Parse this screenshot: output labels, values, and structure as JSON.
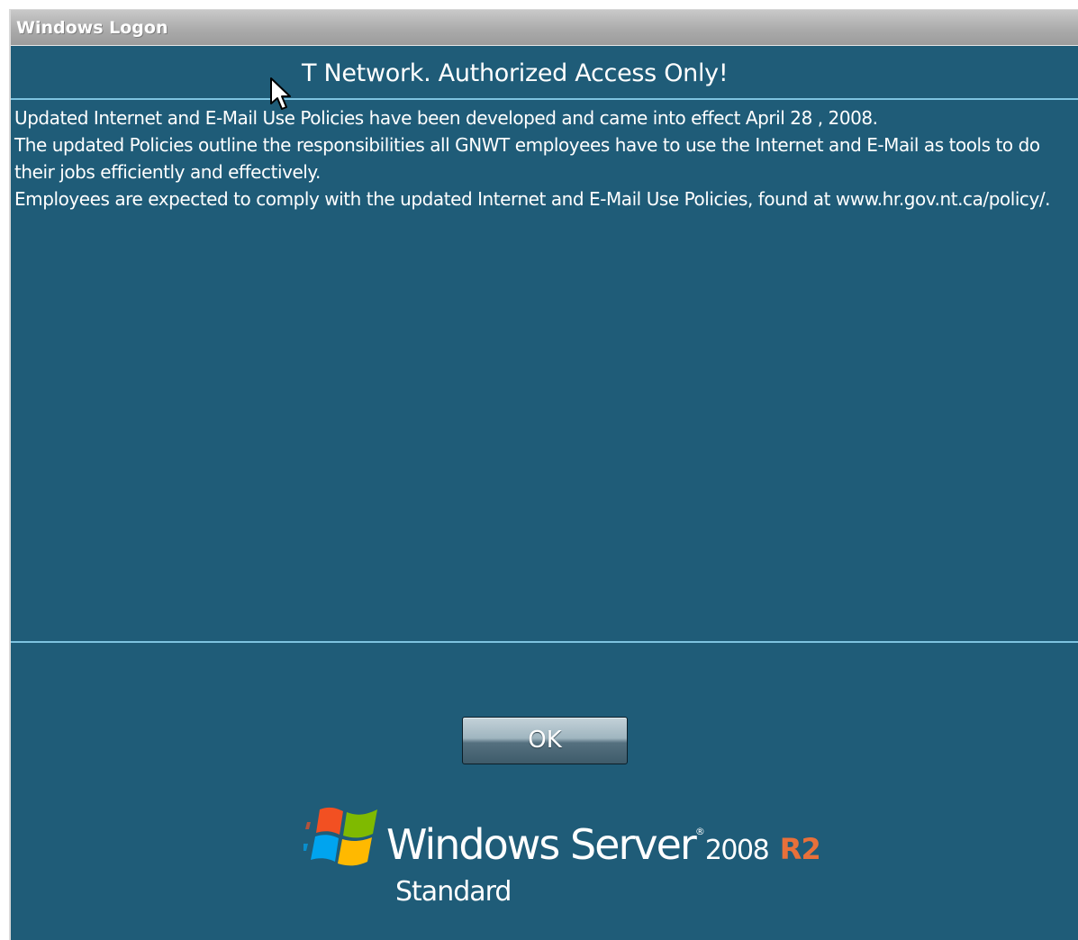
{
  "window": {
    "title": "Windows Logon"
  },
  "banner": {
    "heading": "T Network. Authorized Access Only!",
    "lines": [
      "Updated Internet and E-Mail Use Policies have been developed and came into effect April 28 , 2008.",
      "The updated Policies outline the responsibilities all GNWT employees have to use the Internet and E-Mail as tools to do their jobs efficiently and effectively.",
      "Employees are expected to comply with the updated Internet and E-Mail Use Policies, found at www.hr.gov.nt.ca/policy/."
    ]
  },
  "buttons": {
    "ok_label": "OK"
  },
  "branding": {
    "product": "Windows Server",
    "trademark": "®",
    "version": "2008",
    "release": "R2",
    "edition": "Standard",
    "logo_icon": "windows-flag-icon"
  },
  "colors": {
    "background": "#1f5c78",
    "rule": "#7ec3e0",
    "r2_accent": "#e8703a"
  },
  "cursor": {
    "icon": "mouse-pointer-icon"
  }
}
